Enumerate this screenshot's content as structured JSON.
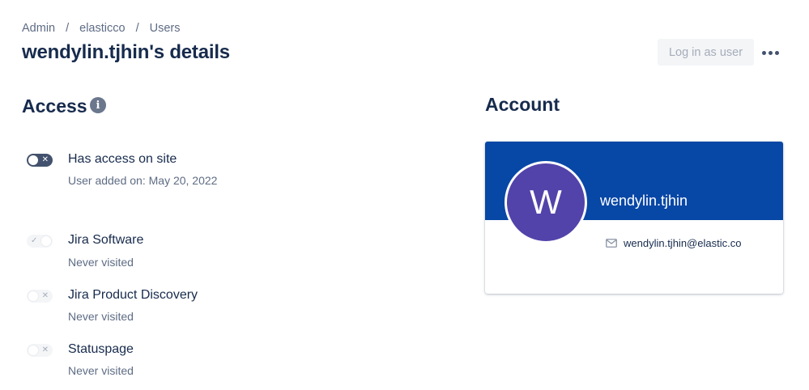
{
  "breadcrumb": {
    "items": [
      "Admin",
      "elasticco",
      "Users"
    ],
    "separator": "/"
  },
  "page": {
    "title": "wendylin.tjhin's details"
  },
  "header_actions": {
    "login_label": "Log in as user",
    "more_icon": "more-horizontal-icon"
  },
  "access": {
    "title": "Access",
    "info_icon": "info-icon",
    "info_glyph": "i",
    "rows": [
      {
        "title": "Has access on site",
        "subtitle": "User added on: May 20, 2022",
        "toggle_state": "off",
        "toggle_glyph": "✕"
      },
      {
        "title": "Jira Software",
        "subtitle": "Never visited",
        "toggle_state": "on-disabled",
        "toggle_glyph": "✓"
      },
      {
        "title": "Jira Product Discovery",
        "subtitle": "Never visited",
        "toggle_state": "off-disabled",
        "toggle_glyph": "✕"
      },
      {
        "title": "Statuspage",
        "subtitle": "Never visited",
        "toggle_state": "off-disabled",
        "toggle_glyph": "✕"
      }
    ]
  },
  "account": {
    "title": "Account",
    "avatar_letter": "W",
    "username": "wendylin.tjhin",
    "email": "wendylin.tjhin@elastic.co",
    "email_icon": "mail-icon",
    "colors": {
      "banner": "#0747a6",
      "avatar": "#5243aa"
    }
  }
}
